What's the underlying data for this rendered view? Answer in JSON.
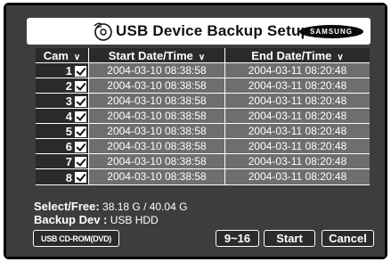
{
  "title": {
    "icon": "usb-device-icon",
    "text": "USB Device Backup Setup",
    "brand": "SAMSUNG"
  },
  "table": {
    "headers": {
      "cam": "Cam",
      "start": "Start Date/Time",
      "end": "End Date/Time",
      "sort_icon": "chevron-down-icon"
    },
    "rows": [
      {
        "cam": "1",
        "checked": true,
        "start": "2004-03-10 08:38:58",
        "end": "2004-03-11 08:20:48"
      },
      {
        "cam": "2",
        "checked": true,
        "start": "2004-03-10 08:38:58",
        "end": "2004-03-11 08:20:48"
      },
      {
        "cam": "3",
        "checked": true,
        "start": "2004-03-10 08:38:58",
        "end": "2004-03-11 08:20:48"
      },
      {
        "cam": "4",
        "checked": true,
        "start": "2004-03-10 08:38:58",
        "end": "2004-03-11 08:20:48"
      },
      {
        "cam": "5",
        "checked": true,
        "start": "2004-03-10 08:38:58",
        "end": "2004-03-11 08:20:48"
      },
      {
        "cam": "6",
        "checked": true,
        "start": "2004-03-10 08:38:58",
        "end": "2004-03-11 08:20:48"
      },
      {
        "cam": "7",
        "checked": true,
        "start": "2004-03-10 08:38:58",
        "end": "2004-03-11 08:20:48"
      },
      {
        "cam": "8",
        "checked": true,
        "start": "2004-03-10 08:38:58",
        "end": "2004-03-11 08:20:48"
      }
    ]
  },
  "info": {
    "select_free_label": "Select/Free:",
    "select_free_value": "38.18 G / 40.04 G",
    "backup_dev_label": "Backup Dev :",
    "backup_dev_value": "USB HDD"
  },
  "buttons": {
    "usb_cdrom": "USB CD-ROM(DVD)",
    "page": "9~16",
    "start": "Start",
    "cancel": "Cancel"
  },
  "colors": {
    "background": "#3d3d3d",
    "row_cell": "#6e6e6e",
    "header_cell": "#2a2a2a"
  }
}
